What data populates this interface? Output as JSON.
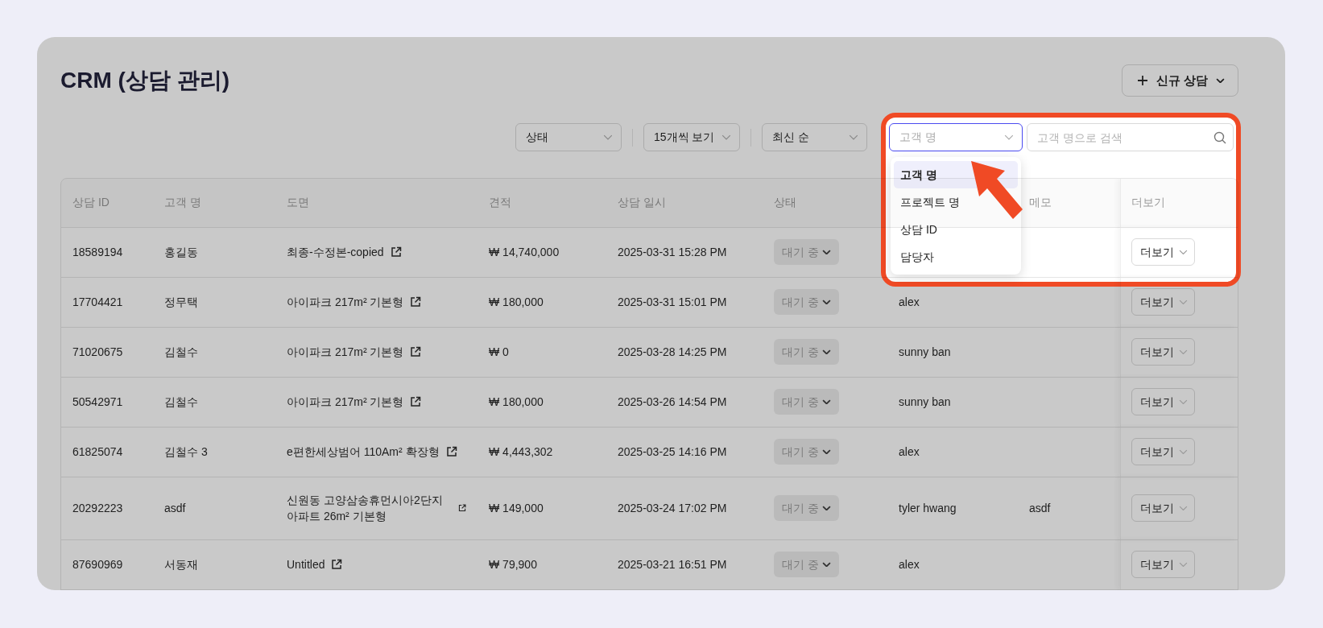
{
  "page": {
    "title": "CRM (상담 관리)"
  },
  "new_button": {
    "label": "신규 상담"
  },
  "filters": [
    {
      "value": "상태"
    },
    {
      "value": "15개씩 보기"
    },
    {
      "value": "최신 순"
    }
  ],
  "search": {
    "type_select": {
      "placeholder": "고객 명",
      "open": true,
      "options": [
        {
          "label": "고객 명",
          "selected": true
        },
        {
          "label": "프로젝트 명",
          "selected": false
        },
        {
          "label": "상담 ID",
          "selected": false
        },
        {
          "label": "담당자",
          "selected": false
        }
      ]
    },
    "placeholder": "고객 명으로 검색"
  },
  "table": {
    "columns": [
      {
        "kind": "plain",
        "label": "상담 ID"
      },
      {
        "kind": "plain",
        "label": "고객 명"
      },
      {
        "kind": "link",
        "label": "도면"
      },
      {
        "kind": "plain",
        "label": "견적"
      },
      {
        "kind": "plain",
        "label": "상담 일시"
      },
      {
        "kind": "status",
        "label": "상태"
      },
      {
        "kind": "plain"
      },
      {
        "kind": "plain",
        "label": "메모"
      },
      {
        "kind": "more",
        "label": "더보기"
      }
    ],
    "rows": [
      {
        "cells": [
          "18589194",
          "홍길동",
          "최종-수정본-copied",
          "₩ 14,740,000",
          "2025-03-31 15:28 PM",
          "대기 중",
          "",
          "",
          "더보기"
        ]
      },
      {
        "cells": [
          "17704421",
          "정무택",
          "아이파크 217m² 기본형",
          "₩ 180,000",
          "2025-03-31 15:01 PM",
          "대기 중",
          "alex",
          "",
          "더보기"
        ]
      },
      {
        "cells": [
          "71020675",
          "김철수",
          "아이파크 217m² 기본형",
          "₩ 0",
          "2025-03-28 14:25 PM",
          "대기 중",
          "sunny ban",
          "",
          "더보기"
        ]
      },
      {
        "cells": [
          "50542971",
          "김철수",
          "아이파크 217m² 기본형",
          "₩ 180,000",
          "2025-03-26 14:54 PM",
          "대기 중",
          "sunny ban",
          "",
          "더보기"
        ]
      },
      {
        "cells": [
          "61825074",
          "김철수 3",
          "e편한세상범어 110Am² 확장형",
          "₩ 4,443,302",
          "2025-03-25 14:16 PM",
          "대기 중",
          "alex",
          "",
          "더보기"
        ]
      },
      {
        "cells": [
          "20292223",
          "asdf",
          "신원동 고양삼송휴먼시아2단지 아파트 26m² 기본형",
          "₩ 149,000",
          "2025-03-24 17:02 PM",
          "대기 중",
          "tyler hwang",
          "asdf",
          "더보기"
        ]
      },
      {
        "cells": [
          "87690969",
          "서동재",
          "Untitled",
          "₩ 79,900",
          "2025-03-21 16:51 PM",
          "대기 중",
          "alex",
          "",
          "더보기"
        ]
      }
    ]
  }
}
